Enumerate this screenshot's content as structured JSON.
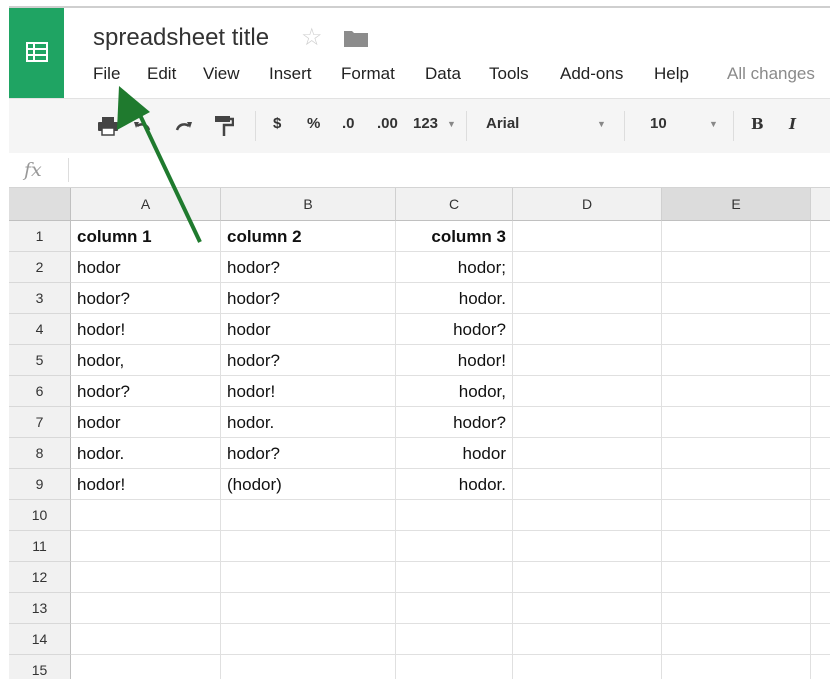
{
  "document": {
    "title": "spreadsheet title",
    "star_icon": "star-icon",
    "folder_icon": "folder-icon",
    "save_status": "All changes"
  },
  "menu": [
    "File",
    "Edit",
    "View",
    "Insert",
    "Format",
    "Data",
    "Tools",
    "Add-ons",
    "Help"
  ],
  "toolbar": {
    "currency": "$",
    "percent": "%",
    "decrease_decimals": ".0",
    "increase_decimals": ".00",
    "more_formats": "123",
    "font": "Arial",
    "font_size": "10",
    "bold": "B",
    "italic": "I"
  },
  "formula_bar": {
    "fx_label": "fx",
    "value": ""
  },
  "columns": [
    "A",
    "B",
    "C",
    "D",
    "E"
  ],
  "selected_column": "E",
  "rows": [
    {
      "n": "1",
      "cells": [
        "column 1",
        "column 2",
        "column 3",
        "",
        ""
      ]
    },
    {
      "n": "2",
      "cells": [
        "hodor",
        "hodor?",
        "hodor;",
        "",
        ""
      ]
    },
    {
      "n": "3",
      "cells": [
        "hodor?",
        "hodor?",
        "hodor.",
        "",
        ""
      ]
    },
    {
      "n": "4",
      "cells": [
        "hodor!",
        "hodor",
        "hodor?",
        "",
        ""
      ]
    },
    {
      "n": "5",
      "cells": [
        "hodor,",
        "hodor?",
        "hodor!",
        "",
        ""
      ]
    },
    {
      "n": "6",
      "cells": [
        "hodor?",
        "hodor!",
        "hodor,",
        "",
        ""
      ]
    },
    {
      "n": "7",
      "cells": [
        "hodor",
        "hodor.",
        "hodor?",
        "",
        ""
      ]
    },
    {
      "n": "8",
      "cells": [
        "hodor.",
        "hodor?",
        "hodor",
        "",
        ""
      ]
    },
    {
      "n": "9",
      "cells": [
        "hodor!",
        "(hodor)",
        "hodor.",
        "",
        ""
      ]
    },
    {
      "n": "10",
      "cells": [
        "",
        "",
        "",
        "",
        ""
      ]
    },
    {
      "n": "11",
      "cells": [
        "",
        "",
        "",
        "",
        ""
      ]
    },
    {
      "n": "12",
      "cells": [
        "",
        "",
        "",
        "",
        ""
      ]
    },
    {
      "n": "13",
      "cells": [
        "",
        "",
        "",
        "",
        ""
      ]
    },
    {
      "n": "14",
      "cells": [
        "",
        "",
        "",
        "",
        ""
      ]
    },
    {
      "n": "15",
      "cells": [
        "",
        "",
        "",
        "",
        ""
      ]
    }
  ],
  "annotation": {
    "arrow_color": "#1f7a2e",
    "points_to": "File"
  },
  "colors": {
    "brand": "#1fa463",
    "header_bg": "#f1f1f1",
    "selected_header_bg": "#dcdcdc"
  }
}
